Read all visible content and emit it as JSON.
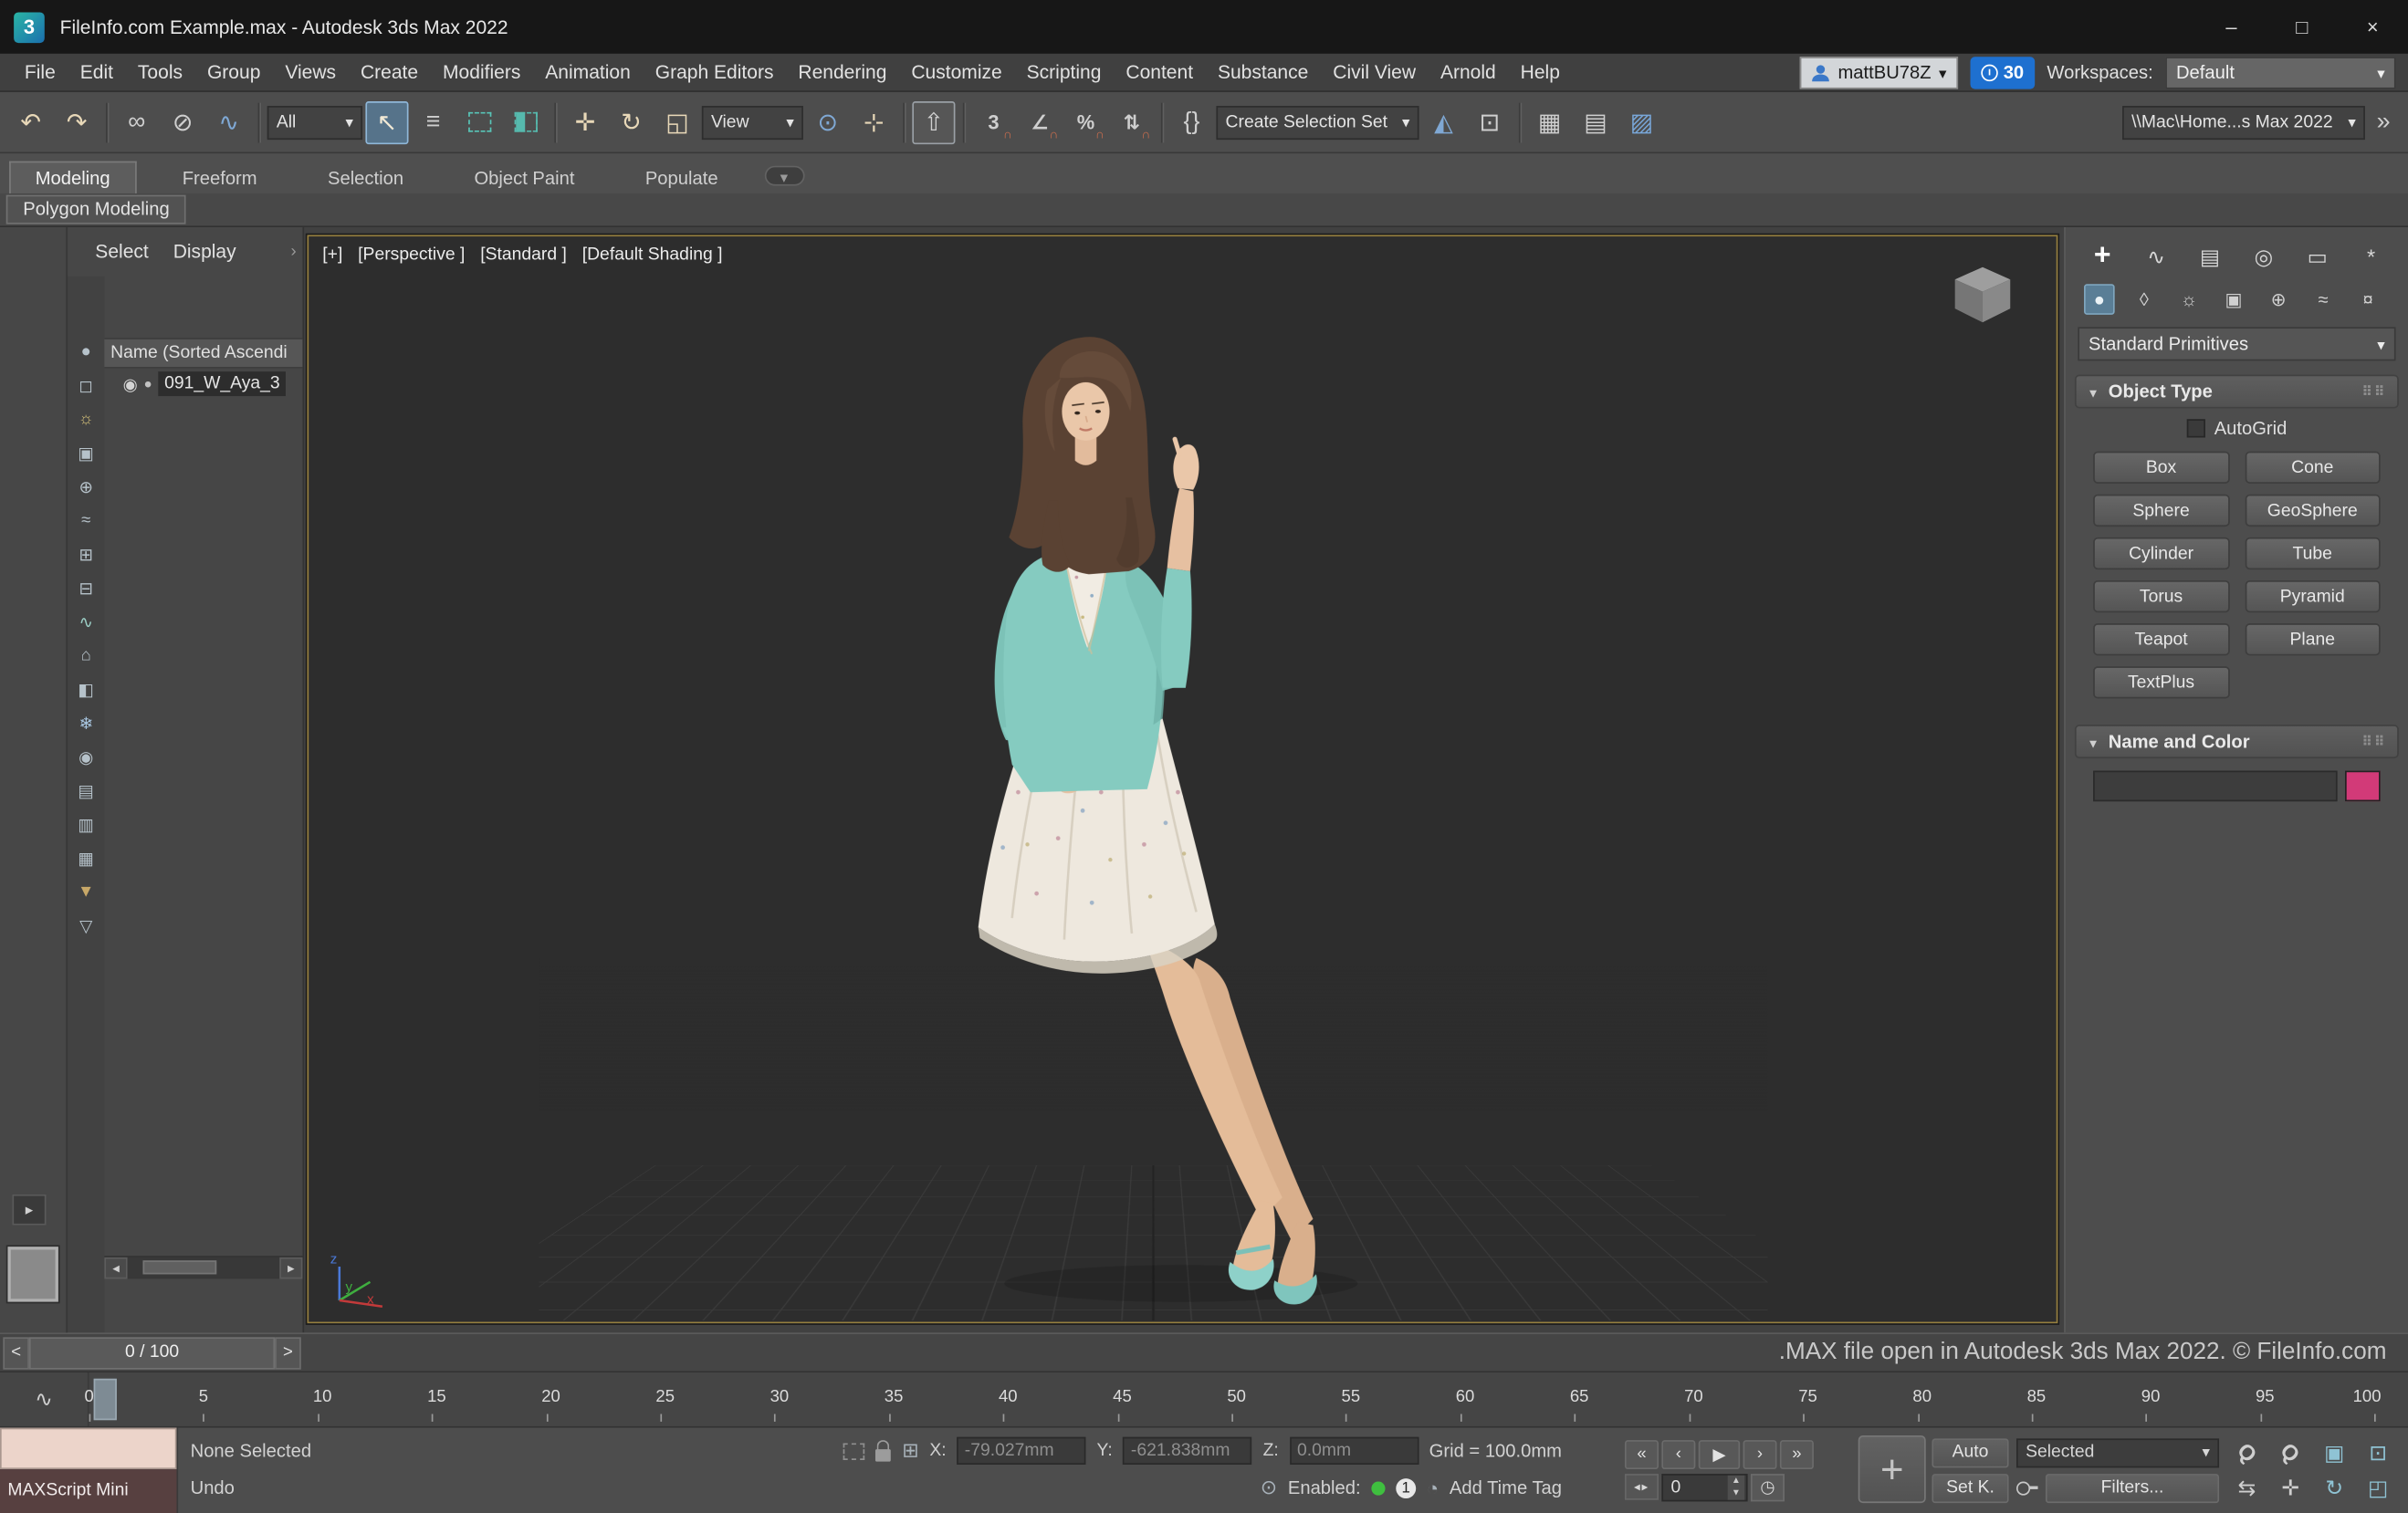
{
  "window": {
    "title": "FileInfo.com Example.max - Autodesk 3ds Max 2022",
    "logo_glyph": "3",
    "minimize_glyph": "–",
    "maximize_glyph": "□",
    "close_glyph": "×"
  },
  "menubar": {
    "items": [
      "File",
      "Edit",
      "Tools",
      "Group",
      "Views",
      "Create",
      "Modifiers",
      "Animation",
      "Graph Editors",
      "Rendering",
      "Customize",
      "Scripting",
      "Content",
      "Substance",
      "Civil View",
      "Arnold",
      "Help"
    ],
    "account_name": "mattBU78Z",
    "clock_count": "30",
    "workspaces_label": "Workspaces:",
    "workspace_value": "Default"
  },
  "toolbar": {
    "filter_value": "All",
    "reference_value": "View",
    "selection_set_value": "Create Selection Set",
    "project_path": "\\\\Mac\\Home...s Max 2022",
    "glyphs": {
      "undo": "↶",
      "redo": "↷",
      "link": "∞",
      "unlink": "⊘",
      "bind": "∿",
      "select": "↖",
      "select_by_name": "≡",
      "move": "✛",
      "rotate": "↻",
      "scale": "◱",
      "pivot": "⊙",
      "manipulate": "⊹",
      "kbd_override": "⇧",
      "snap3": "3",
      "angle": "∠",
      "percent": "%",
      "spinner": "⇅",
      "named_sets": "{}",
      "mirror": "◭",
      "align": "⊡",
      "curve_editor": "▦",
      "schematic": "▤",
      "material": "▨",
      "overflow": "»"
    }
  },
  "ribbon": {
    "tabs": [
      "Modeling",
      "Freeform",
      "Selection",
      "Object Paint",
      "Populate"
    ],
    "subtab": "Polygon Modeling"
  },
  "explorer": {
    "menu_select": "Select",
    "menu_display": "Display",
    "menu_more": "›",
    "header": "Name (Sorted Ascendi",
    "eye_glyph": "◉",
    "dot_glyph": "●",
    "item_label": "091_W_Aya_3",
    "toolbar_icons": [
      {
        "name": "display-geometry-icon",
        "glyph": "●"
      },
      {
        "name": "display-shapes-icon",
        "glyph": "◻"
      },
      {
        "name": "display-lights-icon",
        "glyph": "☼",
        "style": "color:#d6c27a"
      },
      {
        "name": "display-cameras-icon",
        "glyph": "▣"
      },
      {
        "name": "display-helpers-icon",
        "glyph": "⊕"
      },
      {
        "name": "display-spacewarps-icon",
        "glyph": "≈"
      },
      {
        "name": "display-groups-icon",
        "glyph": "⊞"
      },
      {
        "name": "display-xrefs-icon",
        "glyph": "⊟"
      },
      {
        "name": "display-bones-icon",
        "glyph": "∿",
        "style": "color:#9ccfc6"
      },
      {
        "name": "display-containers-icon",
        "glyph": "⌂"
      },
      {
        "name": "display-materials-icon",
        "glyph": "◧"
      },
      {
        "name": "display-frozen-icon",
        "glyph": "❄",
        "style": "color:#a9c7e2"
      },
      {
        "name": "display-hidden-icon",
        "glyph": "◉"
      },
      {
        "name": "sort-by-name-icon",
        "glyph": "▤"
      },
      {
        "name": "sort-by-type-icon",
        "glyph": "▥"
      },
      {
        "name": "sort-by-layer-icon",
        "glyph": "▦"
      },
      {
        "name": "filter-combination-icon",
        "glyph": "▼",
        "style": "color:#c8a868"
      },
      {
        "name": "filter-selection-icon",
        "glyph": "▽"
      }
    ]
  },
  "viewport": {
    "label_plus": "[+]",
    "label_view": "[Perspective ]",
    "label_standard": "[Standard ]",
    "label_shading": "[Default Shading ]",
    "axis_x": "x",
    "axis_y": "y",
    "axis_z": "z"
  },
  "command_panel": {
    "tabs": [
      {
        "name": "create-tab-icon",
        "glyph": "+"
      },
      {
        "name": "modify-tab-icon",
        "glyph": "∿"
      },
      {
        "name": "hierarchy-tab-icon",
        "glyph": "▤"
      },
      {
        "name": "motion-tab-icon",
        "glyph": "◎"
      },
      {
        "name": "display-tab-icon",
        "glyph": "▭"
      },
      {
        "name": "utilities-tab-icon",
        "glyph": "*"
      }
    ],
    "categories": [
      {
        "name": "geometry-category-icon",
        "glyph": "●"
      },
      {
        "name": "shapes-category-icon",
        "glyph": "◊"
      },
      {
        "name": "lights-category-icon",
        "glyph": "☼"
      },
      {
        "name": "cameras-category-icon",
        "glyph": "▣"
      },
      {
        "name": "helpers-category-icon",
        "glyph": "⊕"
      },
      {
        "name": "spacewarps-category-icon",
        "glyph": "≈"
      },
      {
        "name": "systems-category-icon",
        "glyph": "¤"
      }
    ],
    "dropdown_value": "Standard Primitives",
    "object_type_title": "Object Type",
    "autogrid_label": "AutoGrid",
    "object_buttons": [
      "Box",
      "Cone",
      "Sphere",
      "GeoSphere",
      "Cylinder",
      "Tube",
      "Torus",
      "Pyramid",
      "Teapot",
      "Plane",
      "TextPlus"
    ],
    "name_color_title": "Name and Color",
    "swatch_color": "#d23a78",
    "swatch_style": "background:#d23a78"
  },
  "watermark": ".MAX file open in Autodesk 3ds Max 2022. © FileInfo.com",
  "timeline": {
    "prev": "<",
    "next": ">",
    "frame_display": "0 / 100",
    "curve_glyph": "∿",
    "ticks": [
      "0",
      "5",
      "10",
      "15",
      "20",
      "25",
      "30",
      "35",
      "40",
      "45",
      "50",
      "55",
      "60",
      "65",
      "70",
      "75",
      "80",
      "85",
      "90",
      "95",
      "100"
    ]
  },
  "statusbar": {
    "maxscript_label": "MAXScript Mini",
    "selection_status": "None Selected",
    "prompt": "Undo",
    "x_label": "X:",
    "x_value": "-79.027mm",
    "y_label": "Y:",
    "y_value": "-621.838mm",
    "z_label": "Z:",
    "z_value": "0.0mm",
    "grid_text": "Grid = 100.0mm",
    "enabled_label": "Enabled:",
    "enabled_badge": "1",
    "add_time_tag": "Add Time Tag",
    "auto_label": "Auto",
    "set_key_label": "Set K.",
    "selected_value": "Selected",
    "filters_label": "Filters...",
    "frame_value": "0",
    "playback": {
      "start": "«",
      "prev": "‹",
      "play": "▶",
      "next": "›",
      "end": "»",
      "nudge": "◂▸",
      "keymode": "◷"
    },
    "nav_icons": [
      {
        "name": "zoom-icon",
        "glyph": "Q"
      },
      {
        "name": "zoom-all-icon",
        "glyph": "Q"
      },
      {
        "name": "zoom-extents-icon",
        "glyph": "▣",
        "style": "color:#8fc3d4"
      },
      {
        "name": "zoom-region-icon",
        "glyph": "⊡",
        "style": "color:#8fc3d4"
      },
      {
        "name": "pan-2d-icon",
        "glyph": "⇆"
      },
      {
        "name": "pan-hand-icon",
        "glyph": "✛"
      },
      {
        "name": "orbit-icon",
        "glyph": "↻",
        "style": "color:#8fc3d4"
      },
      {
        "name": "maximize-viewport-icon",
        "glyph": "◰",
        "style": "color:#8fc3d4"
      }
    ]
  }
}
